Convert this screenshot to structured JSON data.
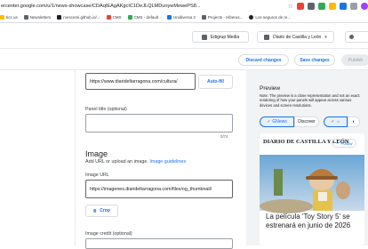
{
  "browser": {
    "url": "ercenter.google.com/u/1/news-showcase/CDAqIEAgAKgcIC1DeJLQLMDunywMewePS8...",
    "bookmarks": [
      "ticz.us",
      "Newsletters",
      "rvescemi.github.io/...",
      "CMS",
      "CMS - default -",
      "Unidiversa 2",
      "Projects - Hiberus...",
      "Los seguros de re..."
    ]
  },
  "topbar": {
    "account": "Edigrup Media",
    "publication": "Diario de Castilla y León",
    "account_caret": "▾",
    "publication_caret": "▾"
  },
  "actions": {
    "discard": "Discard changes",
    "save": "Save changes",
    "publish": "Publish"
  },
  "form": {
    "url_value": "https://www.diarideltarragona.com/cultura/",
    "autofill": "Auto-fill",
    "panel_title_label": "Panel title (optional)",
    "panel_title_counter": "0/74",
    "image_heading": "Image",
    "image_hint": "Add URL or upload an image.",
    "image_guidelines": "Image guidelines",
    "image_url_label": "Image URL",
    "image_url_value": "https://imagenes.diarideltarragona.com/files/og_thumbnail/",
    "crop": "Crop",
    "image_credit_label": "Image credit (optional)"
  },
  "preview": {
    "title": "Preview",
    "note": "Note: The preview is a close representation and not an exact rendering of how your panels will appear across various devices and screen resolutions.",
    "tab_gnews": "GNews",
    "tab_discover": "Discover",
    "publication_name": "DIARIO DE CASTILLA Y LEÓN",
    "follow": "Follow",
    "headline": "La película 'Toy Story 5' se estrenará en junio de 2026"
  },
  "colors": {
    "accent": "#1a73e8",
    "selected_tab_bg": "#e8f0fe",
    "preview_bg": "#f1f3f4"
  }
}
